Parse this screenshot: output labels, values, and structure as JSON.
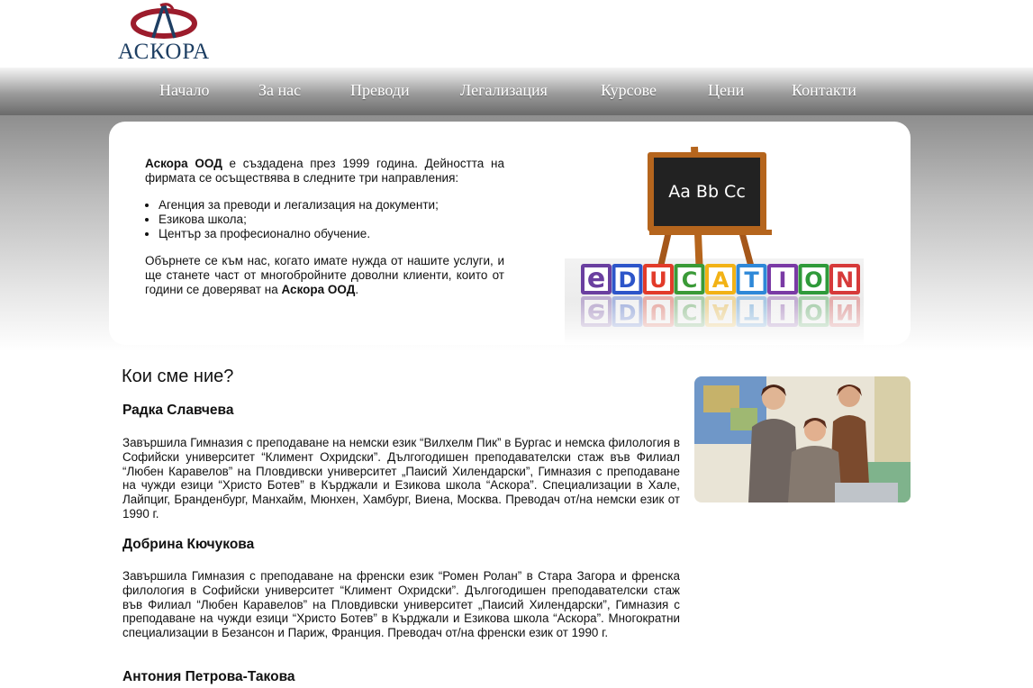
{
  "logo": {
    "text": "АСКОРА"
  },
  "nav": [
    "Начало",
    "За нас",
    "Преводи",
    "Легализация",
    "Курсове",
    "Цени",
    "Контакти"
  ],
  "intro": {
    "company": "Аскора ООД",
    "p1_rest": " е създадена през 1999 година. Дейността на фирмата се осъществява в следните три направления:",
    "items": [
      "Агенция за преводи и легализация на документи;",
      "Езикова школа;",
      "Център за професионално обучение."
    ],
    "p2_start": "Обърнете се към нас, когато имате нужда от нашите услуги, и ще станете част от многобройните доволни клиенти, които от години се доверяват на ",
    "p2_company": "Аскора ООД",
    "p2_end": "."
  },
  "edu_image": {
    "board_text": "Aa Bb Cc",
    "cubes": [
      "e",
      "D",
      "U",
      "C",
      "A",
      "T",
      "I",
      "O",
      "N"
    ]
  },
  "about": {
    "title": "Кои сме ние?",
    "people": [
      {
        "name": "Радка Славчева",
        "bio": "Завършила Гимназия с преподаване на немски език “Вилхелм Пик” в Бургас и немска филология в Софийски университет “Климент Охридски”. Дългогодишен преподавателски стаж във Филиал “Любен Каравелов” на Пловдивски университет „Паисий Хилендарски”, Гимназия с преподаване на чужди езици “Христо Ботев” в Кърджали и Езикова школа “Аскора”. Специализации в Хале, Лайпциг, Бранденбург, Манхайм, Мюнхен, Хамбург, Виена, Москва. Преводач от/на немски език от 1990 г."
      },
      {
        "name": "Добрина Кючукова",
        "bio": "Завършила Гимназия с преподаване на френски език “Ромен Ролан” в Стара Загора и френска филология в Софийски университет “Климент Охридски”. Дългогодишен преподавателски стаж във Филиал “Любен Каравелов” на Пловдивски университет „Паисий Хилендарски”, Гимназия с преподаване на чужди езици “Христо Ботев” в Кърджали и Езикова школа “Аскора”. Многократни специализации в Безансон и Париж, Франция. Преводач от/на френски език от 1990 г."
      },
      {
        "name": "Антония Петрова-Такова",
        "bio": ""
      }
    ]
  },
  "colors": {
    "logo_red": "#9c1c2c",
    "logo_blue": "#1e3f63",
    "nav_text": "#ffffff",
    "cube_colors": [
      "#6a3fa0",
      "#2d55c9",
      "#e23b2a",
      "#3a9a37",
      "#f2b215",
      "#2e88d8",
      "#7a3aa5",
      "#2f9a3a",
      "#d63a3a"
    ]
  }
}
